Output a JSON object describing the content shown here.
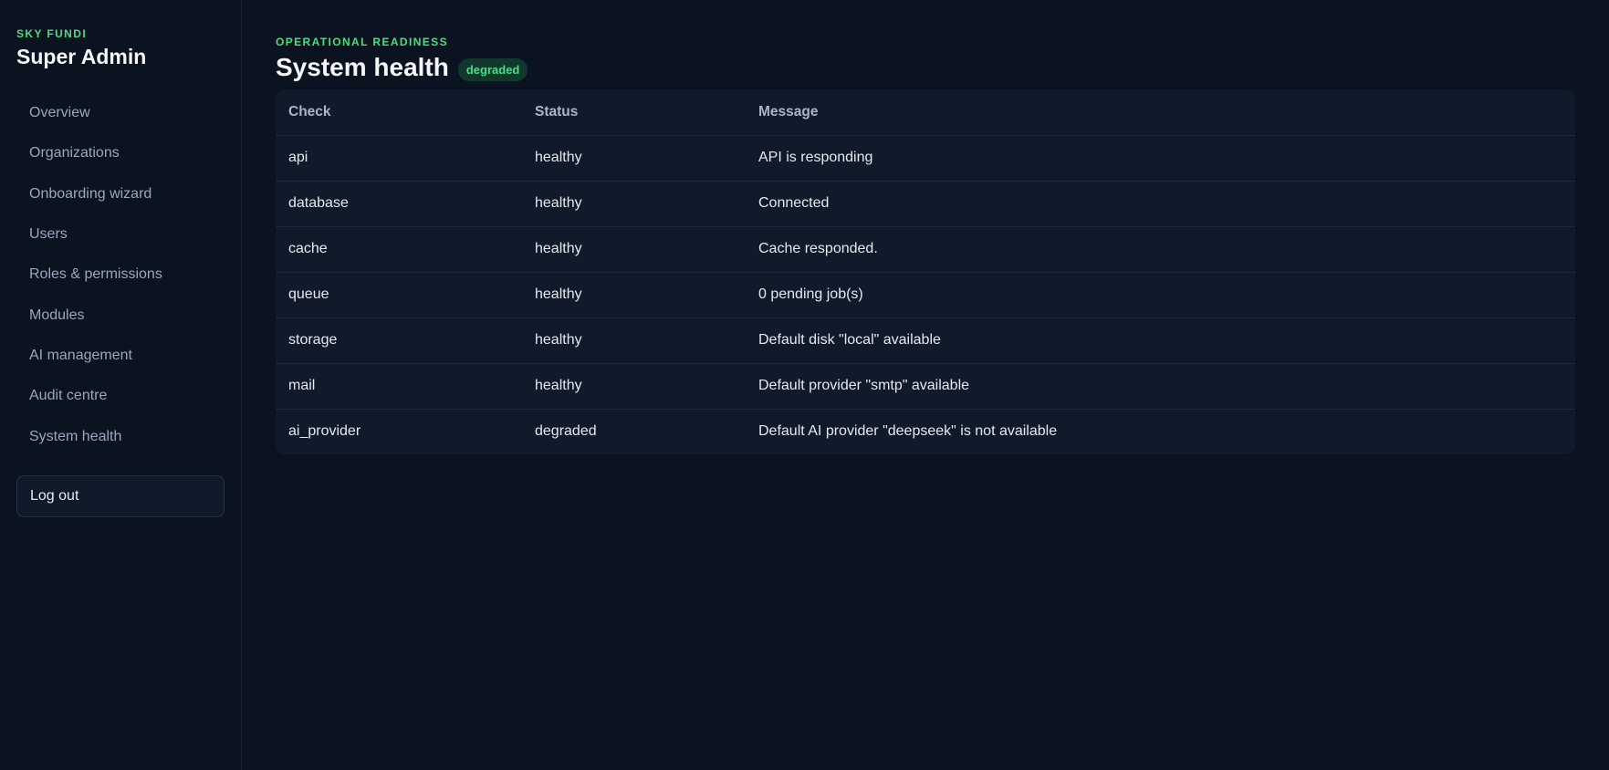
{
  "sidebar": {
    "kicker": "SKY FUNDI",
    "title": "Super Admin",
    "items": [
      {
        "label": "Overview"
      },
      {
        "label": "Organizations"
      },
      {
        "label": "Onboarding wizard"
      },
      {
        "label": "Users"
      },
      {
        "label": "Roles & permissions"
      },
      {
        "label": "Modules"
      },
      {
        "label": "AI management"
      },
      {
        "label": "Audit centre"
      },
      {
        "label": "System health"
      }
    ],
    "logout_label": "Log out"
  },
  "main": {
    "kicker": "OPERATIONAL READINESS",
    "title": "System health",
    "status_badge": "degraded",
    "table": {
      "headers": {
        "check": "Check",
        "status": "Status",
        "message": "Message"
      },
      "rows": [
        {
          "check": "api",
          "status": "healthy",
          "message": "API is responding"
        },
        {
          "check": "database",
          "status": "healthy",
          "message": "Connected"
        },
        {
          "check": "cache",
          "status": "healthy",
          "message": "Cache responded."
        },
        {
          "check": "queue",
          "status": "healthy",
          "message": "0 pending job(s)"
        },
        {
          "check": "storage",
          "status": "healthy",
          "message": "Default disk \"local\" available"
        },
        {
          "check": "mail",
          "status": "healthy",
          "message": "Default provider \"smtp\" available"
        },
        {
          "check": "ai_provider",
          "status": "degraded",
          "message": "Default AI provider \"deepseek\" is not available"
        }
      ]
    }
  },
  "colors": {
    "background": "#0b1220",
    "card": "#111a2b",
    "accent": "#4ade80",
    "badge_bg": "#12372c"
  }
}
